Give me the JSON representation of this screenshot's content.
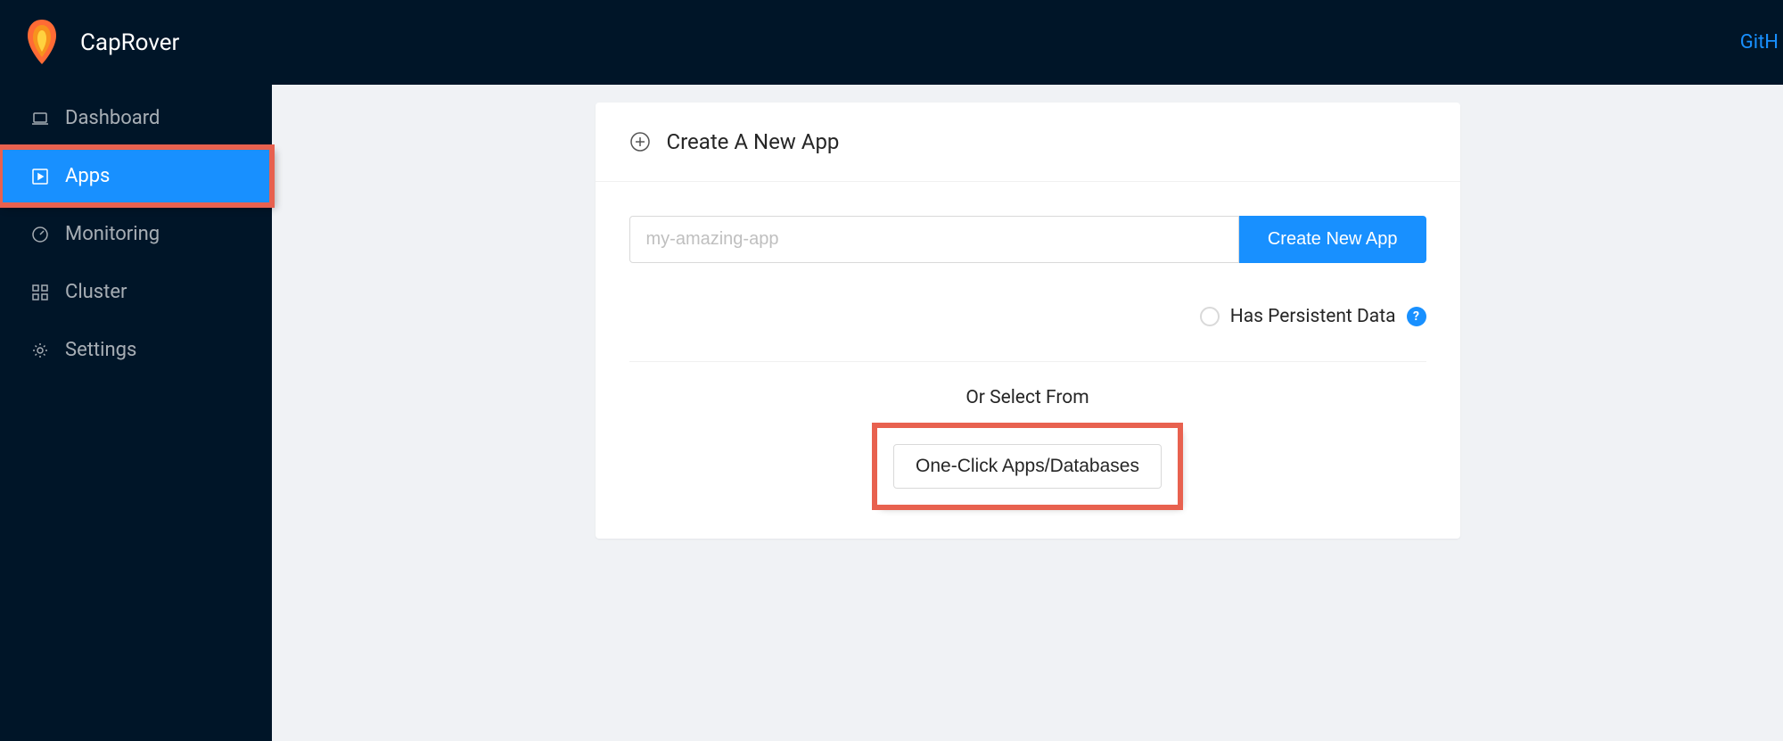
{
  "header": {
    "brand": "CapRover",
    "github_link": "GitH"
  },
  "sidebar": {
    "items": [
      {
        "label": "Dashboard",
        "icon": "laptop-icon",
        "active": false
      },
      {
        "label": "Apps",
        "icon": "play-square-icon",
        "active": true
      },
      {
        "label": "Monitoring",
        "icon": "dashboard-icon",
        "active": false
      },
      {
        "label": "Cluster",
        "icon": "cluster-icon",
        "active": false
      },
      {
        "label": "Settings",
        "icon": "gear-icon",
        "active": false
      }
    ]
  },
  "card": {
    "title": "Create A New App",
    "input_placeholder": "my-amazing-app",
    "create_button": "Create New App",
    "persistent_label": "Has Persistent Data",
    "select_from_label": "Or Select From",
    "oneclick_button": "One-Click Apps/Databases"
  }
}
